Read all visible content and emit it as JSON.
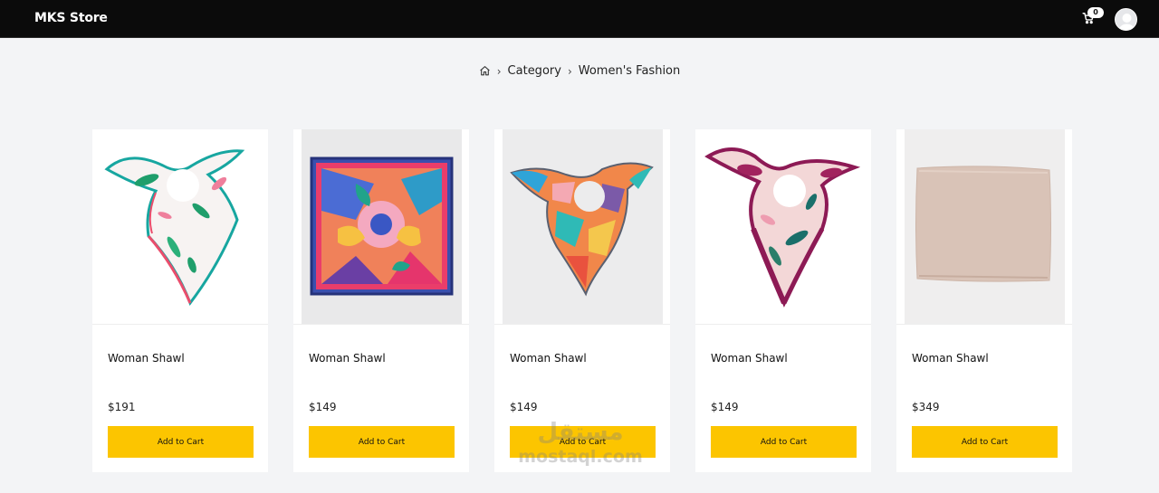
{
  "header": {
    "brand": "MKS Store",
    "cart_count": "0",
    "cart_icon": "cart-icon",
    "avatar_icon": "user-avatar-icon"
  },
  "breadcrumb": {
    "home_icon": "home-icon",
    "items": [
      "Category",
      "Women's Fashion"
    ]
  },
  "products": [
    {
      "name": "Woman Shawl",
      "price": "$191",
      "button": "Add to Cart"
    },
    {
      "name": "Woman Shawl",
      "price": "$149",
      "button": "Add to Cart"
    },
    {
      "name": "Woman Shawl",
      "price": "$149",
      "button": "Add to Cart"
    },
    {
      "name": "Woman Shawl",
      "price": "$149",
      "button": "Add to Cart"
    },
    {
      "name": "Woman Shawl",
      "price": "$349",
      "button": "Add to Cart"
    }
  ],
  "watermark": {
    "arabic": "مستقل",
    "latin": "mostaql.com"
  },
  "colors": {
    "header_bg": "#0b0b0b",
    "page_bg": "#f3f4f6",
    "button_bg": "#fcc500"
  }
}
